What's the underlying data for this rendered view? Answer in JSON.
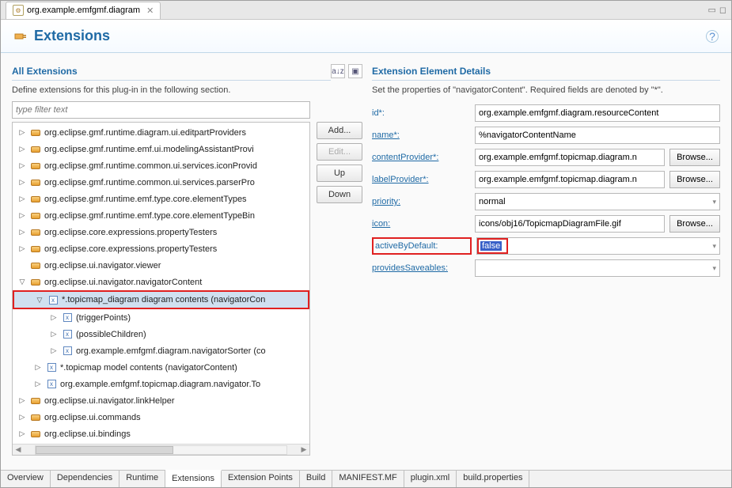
{
  "tab": {
    "title": "org.example.emfgmf.diagram"
  },
  "page_title": "Extensions",
  "left": {
    "title": "All Extensions",
    "subtitle": "Define extensions for this plug-in in the following section.",
    "filter_placeholder": "type filter text"
  },
  "buttons": {
    "add": "Add...",
    "edit": "Edit...",
    "up": "Up",
    "down": "Down"
  },
  "tree": [
    {
      "d": 0,
      "t": "▷",
      "i": "plug",
      "l": "org.eclipse.gmf.runtime.diagram.ui.editpartProviders"
    },
    {
      "d": 0,
      "t": "▷",
      "i": "plug",
      "l": "org.eclipse.gmf.runtime.emf.ui.modelingAssistantProvi"
    },
    {
      "d": 0,
      "t": "▷",
      "i": "plug",
      "l": "org.eclipse.gmf.runtime.common.ui.services.iconProvid"
    },
    {
      "d": 0,
      "t": "▷",
      "i": "plug",
      "l": "org.eclipse.gmf.runtime.common.ui.services.parserPro"
    },
    {
      "d": 0,
      "t": "▷",
      "i": "plug",
      "l": "org.eclipse.gmf.runtime.emf.type.core.elementTypes"
    },
    {
      "d": 0,
      "t": "▷",
      "i": "plug",
      "l": "org.eclipse.gmf.runtime.emf.type.core.elementTypeBin"
    },
    {
      "d": 0,
      "t": "▷",
      "i": "plug",
      "l": "org.eclipse.core.expressions.propertyTesters"
    },
    {
      "d": 0,
      "t": "▷",
      "i": "plug",
      "l": "org.eclipse.core.expressions.propertyTesters"
    },
    {
      "d": 0,
      "t": "",
      "i": "plug",
      "l": "org.eclipse.ui.navigator.viewer"
    },
    {
      "d": 0,
      "t": "▽",
      "i": "plug",
      "l": "org.eclipse.ui.navigator.navigatorContent"
    },
    {
      "d": 1,
      "t": "▽",
      "i": "x",
      "l": "*.topicmap_diagram diagram contents (navigatorCon",
      "sel": true
    },
    {
      "d": 2,
      "t": "▷",
      "i": "x",
      "l": "(triggerPoints)"
    },
    {
      "d": 2,
      "t": "▷",
      "i": "x",
      "l": "(possibleChildren)"
    },
    {
      "d": 2,
      "t": "▷",
      "i": "x",
      "l": "org.example.emfgmf.diagram.navigatorSorter (co"
    },
    {
      "d": 1,
      "t": "▷",
      "i": "x",
      "l": "*.topicmap model contents (navigatorContent)"
    },
    {
      "d": 1,
      "t": "▷",
      "i": "x",
      "l": "org.example.emfgmf.topicmap.diagram.navigator.To"
    },
    {
      "d": 0,
      "t": "▷",
      "i": "plug",
      "l": "org.eclipse.ui.navigator.linkHelper"
    },
    {
      "d": 0,
      "t": "▷",
      "i": "plug",
      "l": "org.eclipse.ui.commands"
    },
    {
      "d": 0,
      "t": "▷",
      "i": "plug",
      "l": "org.eclipse.ui.bindings"
    }
  ],
  "details": {
    "title": "Extension Element Details",
    "subtitle": "Set the properties of \"navigatorContent\". Required fields are denoted by \"*\".",
    "rows": {
      "id_label": "id*:",
      "id_val": "org.example.emfgmf.diagram.resourceContent",
      "name_label": "name*:",
      "name_val": "%navigatorContentName",
      "cp_label": "contentProvider*:",
      "cp_val": "org.example.emfgmf.topicmap.diagram.n",
      "lp_label": "labelProvider*:",
      "lp_val": "org.example.emfgmf.topicmap.diagram.n",
      "priority_label": "priority:",
      "priority_val": "normal",
      "icon_label": "icon:",
      "icon_val": "icons/obj16/TopicmapDiagramFile.gif",
      "abd_label": "activeByDefault:",
      "abd_val": "false",
      "ps_label": "providesSaveables:",
      "ps_val": "",
      "browse": "Browse..."
    }
  },
  "bottom_tabs": [
    "Overview",
    "Dependencies",
    "Runtime",
    "Extensions",
    "Extension Points",
    "Build",
    "MANIFEST.MF",
    "plugin.xml",
    "build.properties"
  ],
  "active_tab_index": 3
}
